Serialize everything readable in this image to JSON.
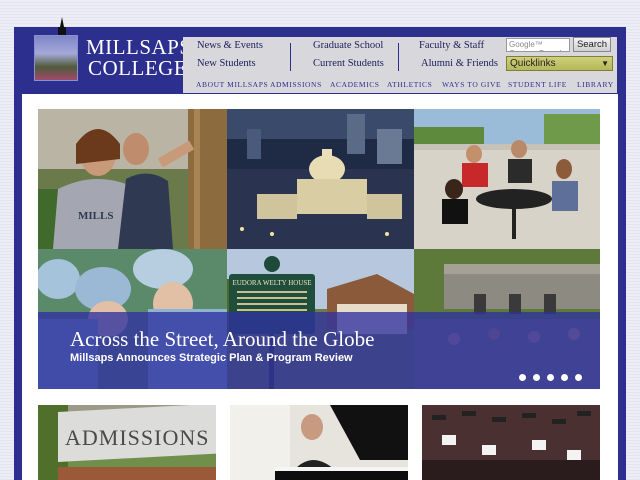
{
  "site": {
    "name_line1": "MILLSAPS",
    "name_line2": "COLLEGE"
  },
  "nav": {
    "row1": [
      "News & Events",
      "Graduate School",
      "Faculty & Staff"
    ],
    "row2": [
      "New Students",
      "Current Students",
      "Alumni & Friends"
    ]
  },
  "search": {
    "placeholder": "Google™ Custom Search",
    "button_label": "Search"
  },
  "quicklinks": {
    "label": "Quicklinks"
  },
  "subnav": [
    "ABOUT MILLSAPS",
    "ADMISSIONS",
    "ACADEMICS",
    "ATHLETICS",
    "WAYS TO GIVE",
    "STUDENT LIFE",
    "LIBRARY"
  ],
  "hero": {
    "title": "Across the Street, Around the Globe",
    "subtitle": "Millsaps Announces Strategic Plan & Program Review",
    "slide_count": 5,
    "sign_text": "EUDORA WELTY HOUSE"
  },
  "bottom": {
    "admissions_sign": "ADMISSIONS"
  },
  "colors": {
    "brand_blue": "#2c2f8e",
    "nav_gray": "#d8d8dc",
    "quicklinks_olive": "#c2c46a"
  }
}
